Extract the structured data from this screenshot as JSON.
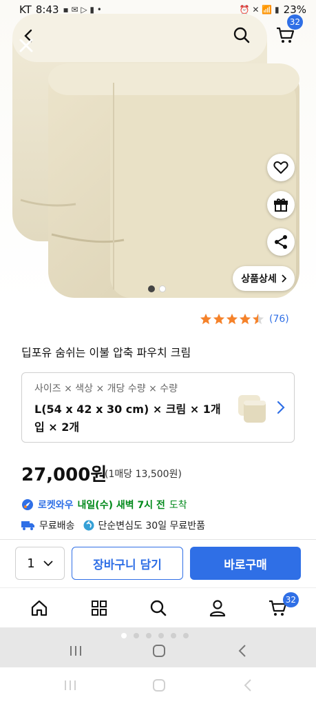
{
  "status_bar": {
    "carrier": "KT",
    "time": "8:43",
    "battery": "23%"
  },
  "header": {
    "back_icon": "chevron-left-icon",
    "close_icon": "close-icon",
    "search_icon": "search-icon",
    "cart_icon": "cart-icon",
    "cart_count": "32"
  },
  "side_actions": {
    "wishlist_icon": "heart-icon",
    "gift_icon": "gift-icon",
    "share_icon": "share-icon",
    "detail_label": "상품상세"
  },
  "gallery": {
    "page_count": 2,
    "active_page": 1
  },
  "rating": {
    "stars": 4.5,
    "count_text": "(76)"
  },
  "product": {
    "title": "딥포유 숨쉬는 이불 압축 파우치 크림",
    "option_labels": "사이즈 × 색상 × 개당 수량 × 수량",
    "option_value": "L(54 x 42 x 30 cm) × 크림 × 1개입 × 2개",
    "price": "27,000원",
    "unit_price": "(1매당 13,500원)"
  },
  "delivery": {
    "brand": "로켓와우",
    "arrival": "내일(수) 새벽 7시 전",
    "arrival_suffix": "도착",
    "free_shipping": "무료배송",
    "free_return": "단순변심도 30일 무료반품"
  },
  "purchase": {
    "quantity": "1",
    "add_to_cart": "장바구니 담기",
    "buy_now": "바로구매"
  },
  "tab_bar": {
    "items": [
      "home-icon",
      "category-grid-icon",
      "search-icon",
      "user-icon",
      "cart-icon"
    ],
    "cart_count": "32"
  },
  "colors": {
    "accent": "#2f6fe6",
    "rocket_green": "#00891a",
    "star": "#f5822a"
  }
}
